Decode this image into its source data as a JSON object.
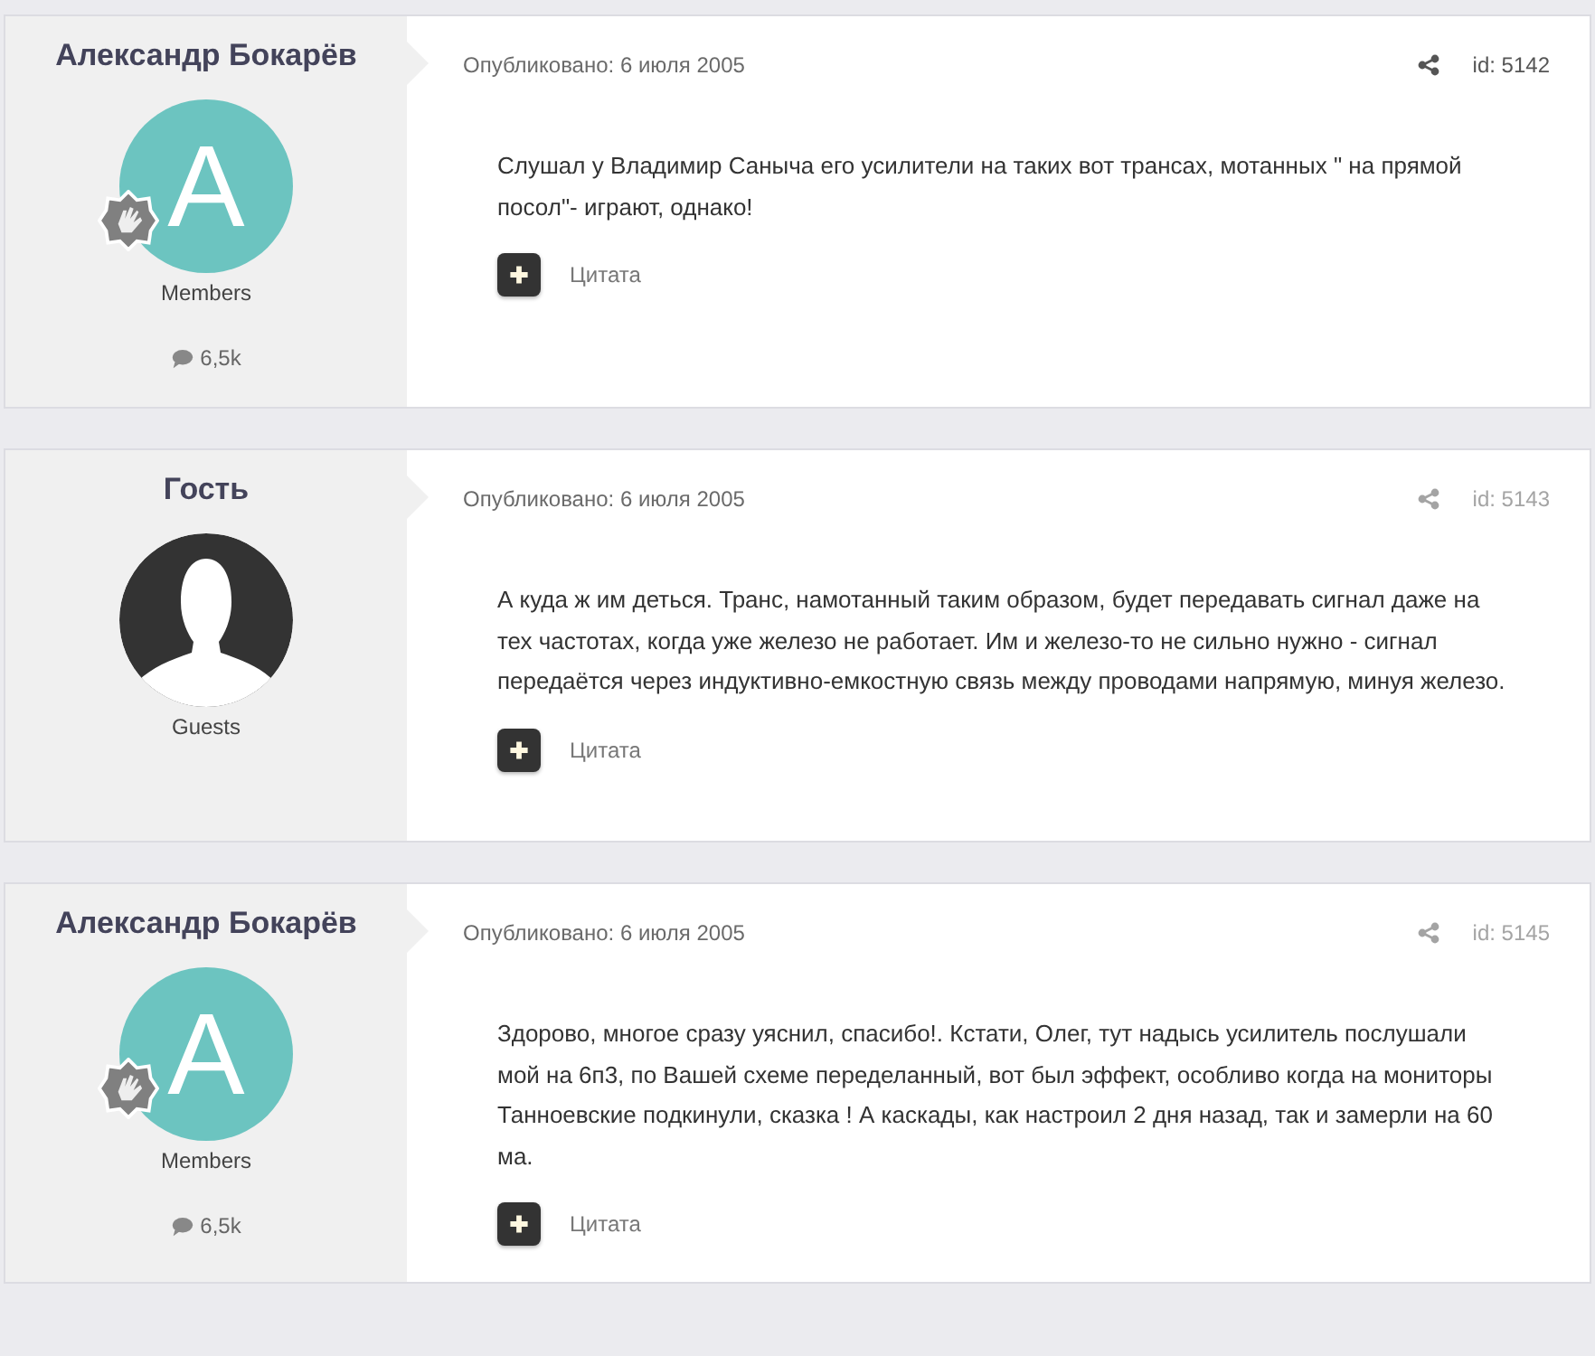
{
  "posts": [
    {
      "author": "Александр Бокарёв",
      "avatar": {
        "kind": "letter",
        "letter": "A"
      },
      "badge": true,
      "group": "Members",
      "post_count": "6,5k",
      "date": "Опубликовано: 6 июля 2005",
      "id": "id: 5142",
      "dimmed": false,
      "body": "Слушал у Владимир Саныча его усилители на таких вот трансах, мотанных \" на прямой посол\"- играют, однако!",
      "quote": "Цитата"
    },
    {
      "author": "Гость",
      "avatar": {
        "kind": "guest"
      },
      "badge": false,
      "group": "Guests",
      "date": "Опубликовано: 6 июля 2005",
      "id": "id: 5143",
      "dimmed": true,
      "body": "А куда ж им деться. Транс, намотанный таким образом, будет передавать сигнал даже на тех частотах, когда уже железо не работает. Им и железо-то не сильно нужно - сигнал передаётся через индуктивно-емкостную связь между проводами напрямую, минуя железо.",
      "quote": "Цитата"
    },
    {
      "author": "Александр Бокарёв",
      "avatar": {
        "kind": "letter",
        "letter": "A"
      },
      "badge": true,
      "group": "Members",
      "post_count": "6,5k",
      "date": "Опубликовано: 6 июля 2005",
      "id": "id: 5145",
      "dimmed": true,
      "body": "Здорово, многое сразу уяснил, спасибо!. Кстати, Олег, тут надысь усилитель послушали мой на 6п3, по Вашей схеме переделанный, вот был эффект, особливо когда на мониторы Танноевские подкинули, сказка ! А каскады, как настроил 2 дня назад, так и замерли на 60 ма.",
      "quote": "Цитата"
    }
  ]
}
